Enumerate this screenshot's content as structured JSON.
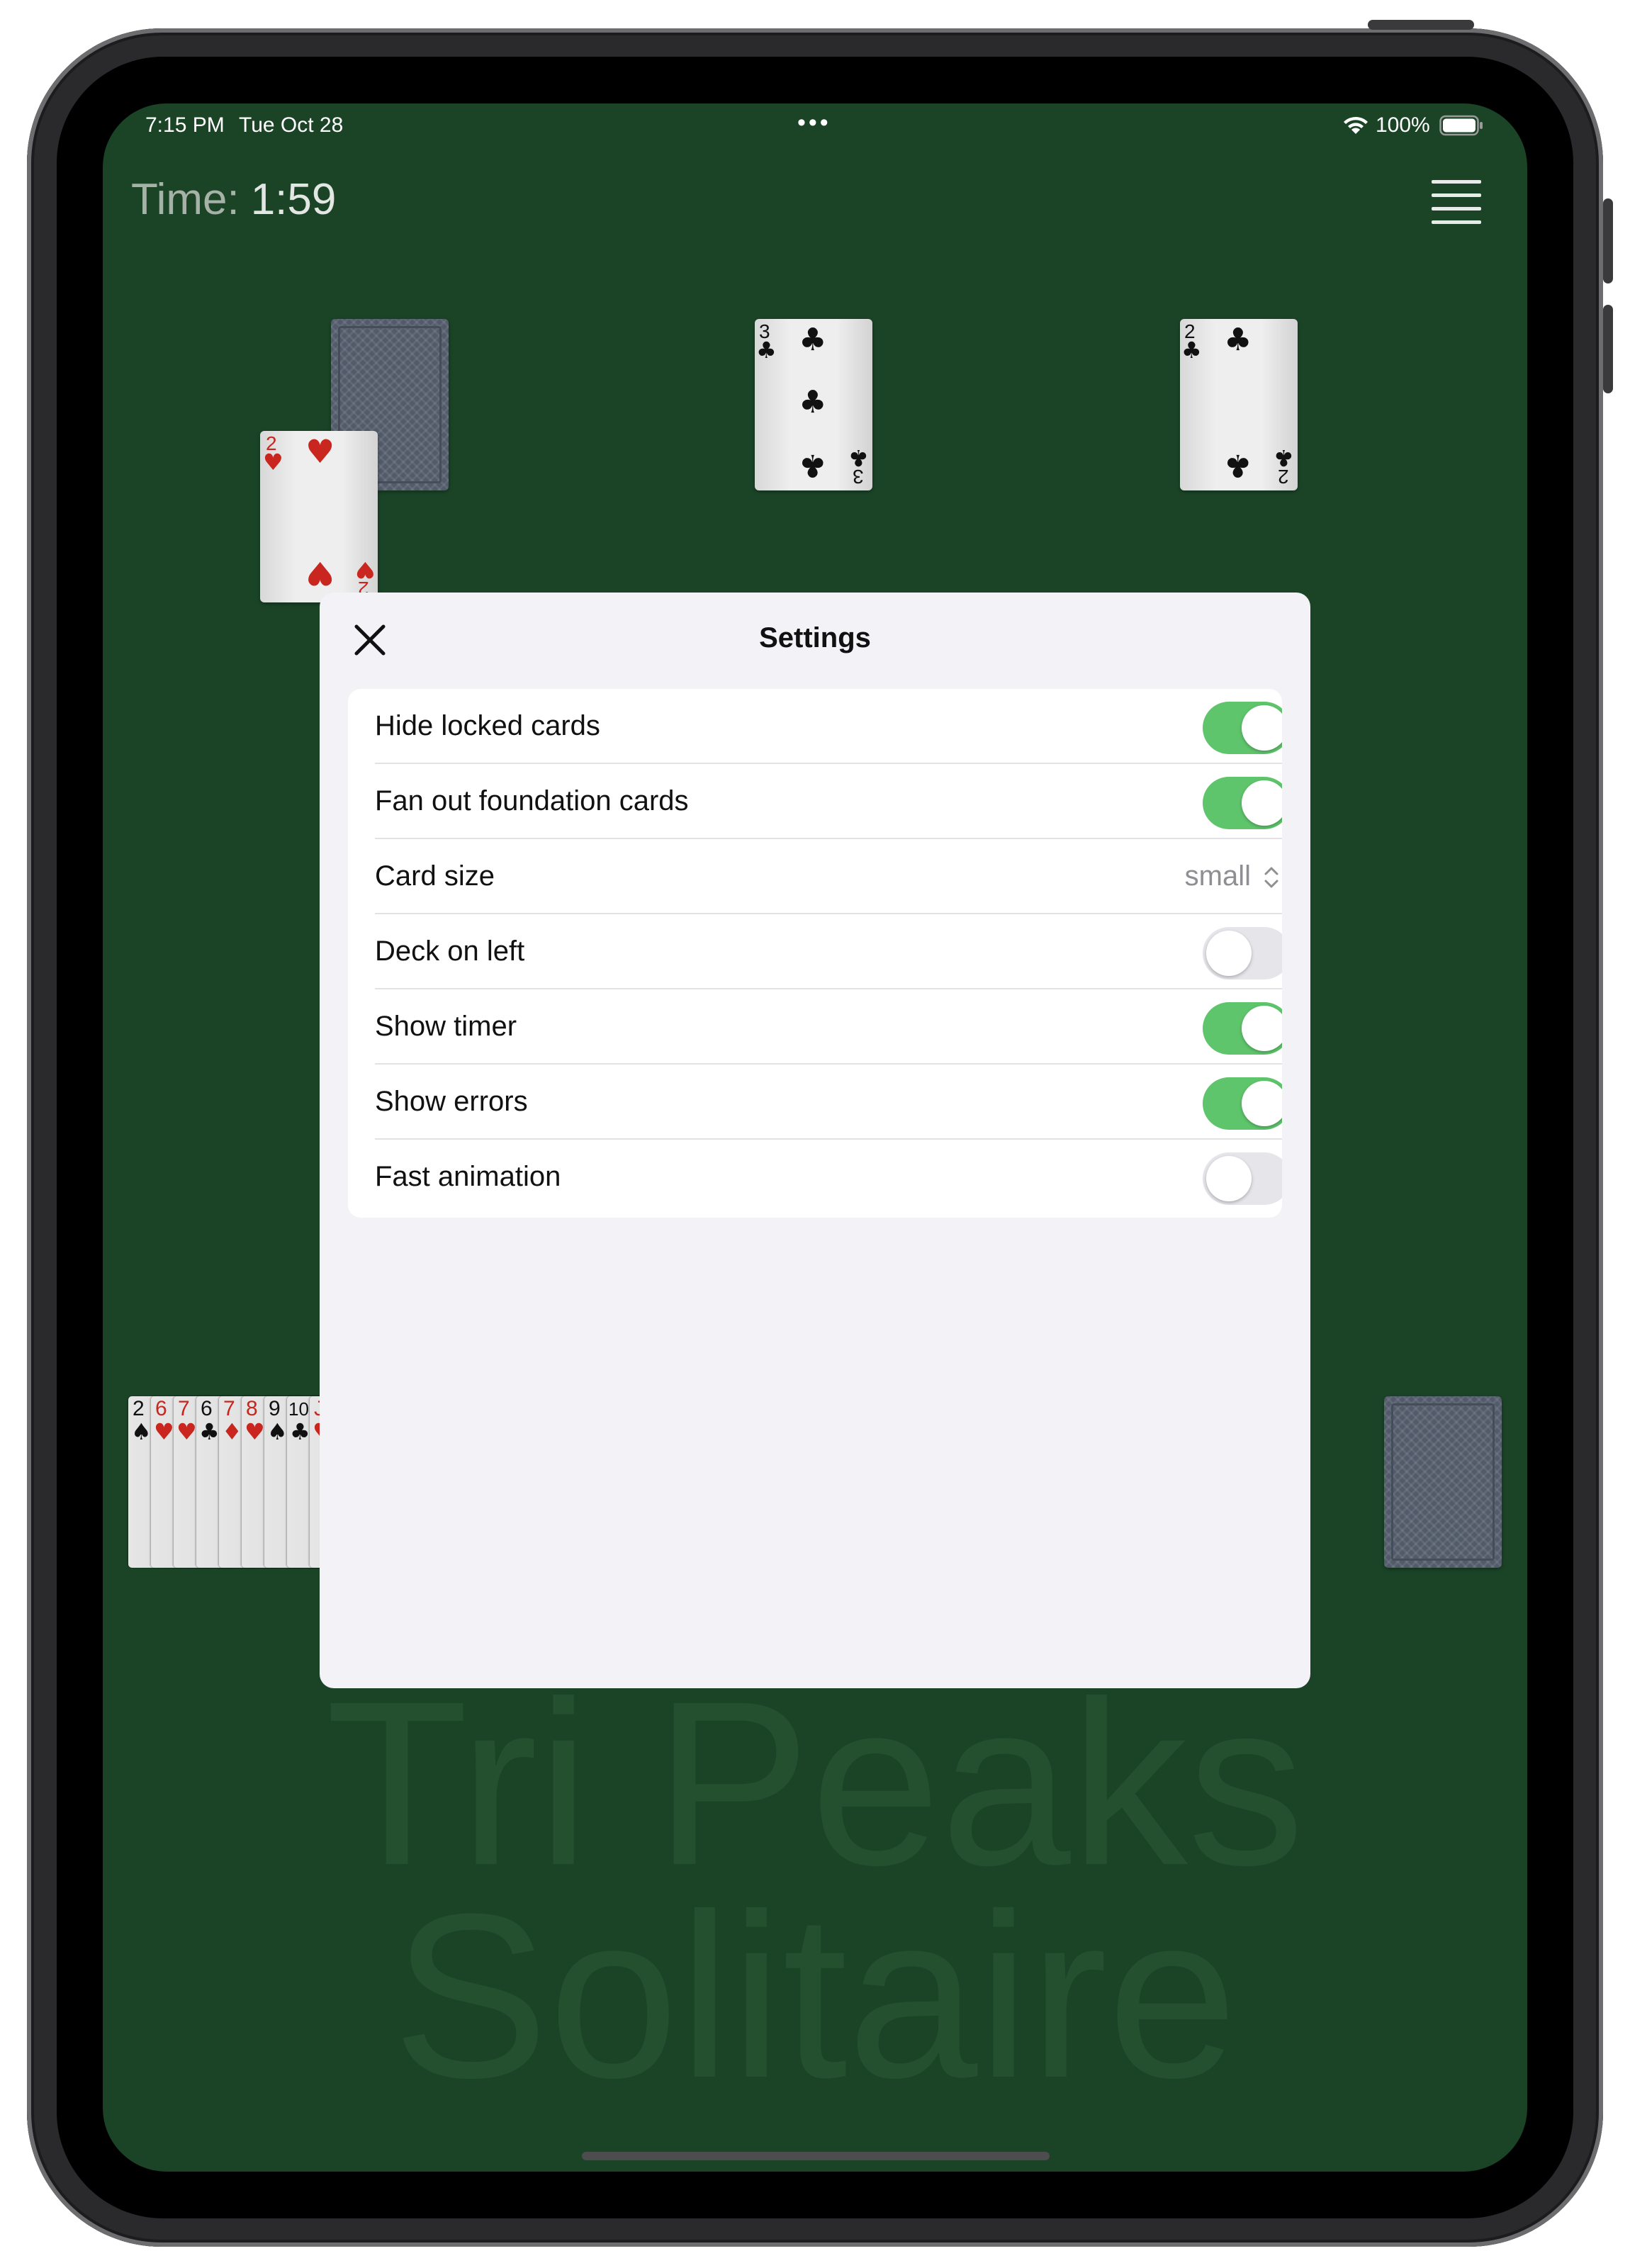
{
  "status_bar": {
    "time": "7:15 PM",
    "date": "Tue Oct 28",
    "dots": "•••",
    "battery": "100%"
  },
  "game": {
    "timer_label": "Time:",
    "timer_value": "1:59",
    "watermark_top": "Tri Peaks",
    "watermark_bottom": "Solitaire",
    "peak_cards": [
      {
        "rank": "2",
        "suit": "♥",
        "color": "red"
      },
      {
        "rank": "3",
        "suit": "♣",
        "color": "black"
      },
      {
        "rank": "2",
        "suit": "♣",
        "color": "black"
      }
    ],
    "tray_cards": [
      {
        "rank": "2",
        "suit": "♠",
        "color": "black"
      },
      {
        "rank": "6",
        "suit": "♥",
        "color": "red"
      },
      {
        "rank": "7",
        "suit": "♥",
        "color": "red"
      },
      {
        "rank": "6",
        "suit": "♣",
        "color": "black"
      },
      {
        "rank": "7",
        "suit": "♦",
        "color": "red"
      },
      {
        "rank": "8",
        "suit": "♥",
        "color": "red"
      },
      {
        "rank": "9",
        "suit": "♠",
        "color": "black"
      },
      {
        "rank": "10",
        "suit": "♣",
        "color": "black"
      },
      {
        "rank": "J",
        "suit": "♥",
        "color": "red"
      }
    ]
  },
  "settings": {
    "title": "Settings",
    "rows": [
      {
        "label": "Hide locked cards",
        "type": "toggle",
        "on": true
      },
      {
        "label": "Fan out foundation cards",
        "type": "toggle",
        "on": true
      },
      {
        "label": "Card size",
        "type": "select",
        "value": "small"
      },
      {
        "label": "Deck on left",
        "type": "toggle",
        "on": false
      },
      {
        "label": "Show timer",
        "type": "toggle",
        "on": true
      },
      {
        "label": "Show errors",
        "type": "toggle",
        "on": true
      },
      {
        "label": "Fast animation",
        "type": "toggle",
        "on": false
      }
    ]
  },
  "colors": {
    "table_green": "#1b4427",
    "toggle_on": "#5fc56c",
    "toggle_off": "#e5e5ea",
    "card_red": "#c8261f"
  }
}
